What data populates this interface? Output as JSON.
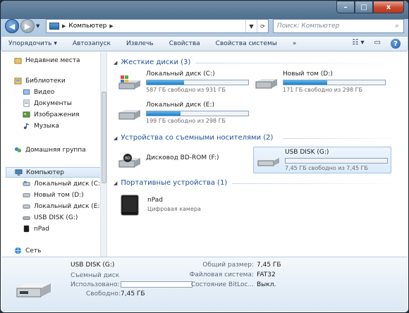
{
  "window": {
    "controls": {
      "minimize": "–",
      "maximize": "□",
      "close": "x"
    }
  },
  "address": {
    "path": "Компьютер",
    "search_placeholder": "Поиск: Компьютер"
  },
  "toolbar": {
    "items": [
      "Упорядочить",
      "Автозапуск",
      "Извлечь",
      "Свойства",
      "Свойства системы",
      "»"
    ]
  },
  "nav": {
    "items": [
      {
        "label": "Недавние места",
        "icon": "recent-places-icon"
      },
      {
        "label": "Библиотеки",
        "icon": "libraries-icon"
      },
      {
        "label": "Видео",
        "icon": "video-icon"
      },
      {
        "label": "Документы",
        "icon": "documents-icon"
      },
      {
        "label": "Изображения",
        "icon": "pictures-icon"
      },
      {
        "label": "Музыка",
        "icon": "music-icon"
      },
      {
        "label": "Домашняя группа",
        "icon": "homegroup-icon"
      },
      {
        "label": "Компьютер",
        "icon": "computer-icon"
      },
      {
        "label": "Локальный диск (C:)",
        "icon": "drive-icon"
      },
      {
        "label": "Новый том (D:)",
        "icon": "drive-icon"
      },
      {
        "label": "Локальный диск (E:)",
        "icon": "drive-icon"
      },
      {
        "label": "USB DISK (G:)",
        "icon": "usb-drive-icon"
      },
      {
        "label": "nPad",
        "icon": "device-icon"
      },
      {
        "label": "Сеть",
        "icon": "network-icon"
      }
    ]
  },
  "groups": {
    "hard_disks": {
      "title": "Жесткие диски (3)"
    },
    "removable": {
      "title": "Устройства со съемными носителями (2)"
    },
    "portable": {
      "title": "Портативные устройства (1)"
    }
  },
  "drives": [
    {
      "name": "Локальный диск (C:)",
      "info": "587 ГБ свободно из 931 ГБ",
      "used_fraction": 0.37
    },
    {
      "name": "Новый том (D:)",
      "info": "171 ГБ свободно из 298 ГБ",
      "used_fraction": 0.43
    },
    {
      "name": "Локальный диск (E:)",
      "info": "199 ГБ свободно из 298 ГБ",
      "used_fraction": 0.33
    },
    {
      "name": "Дисковод BD-ROM (F:)"
    },
    {
      "name": "USB DISK (G:)",
      "info": "7,45 ГБ свободно из 7,45 ГБ",
      "used_fraction": 0.0
    },
    {
      "name": "nPad",
      "info": "Цифровая камера"
    }
  ],
  "details": {
    "title": "USB DISK (G:)",
    "type": "Съемный диск",
    "used_label": "Использовано:",
    "free_label": "Свободно:",
    "free_value": "7,45 ГБ",
    "total_label": "Общий размер:",
    "total_value": "7,45 ГБ",
    "fs_label": "Файловая система:",
    "fs_value": "FAT32",
    "bitlocker_label": "Состояние BitLoc...",
    "bitlocker_value": "Выкл.",
    "used_fraction": 0.0
  },
  "colors": {
    "accent": "#1e4f97",
    "bar": "#1b7ec8"
  }
}
